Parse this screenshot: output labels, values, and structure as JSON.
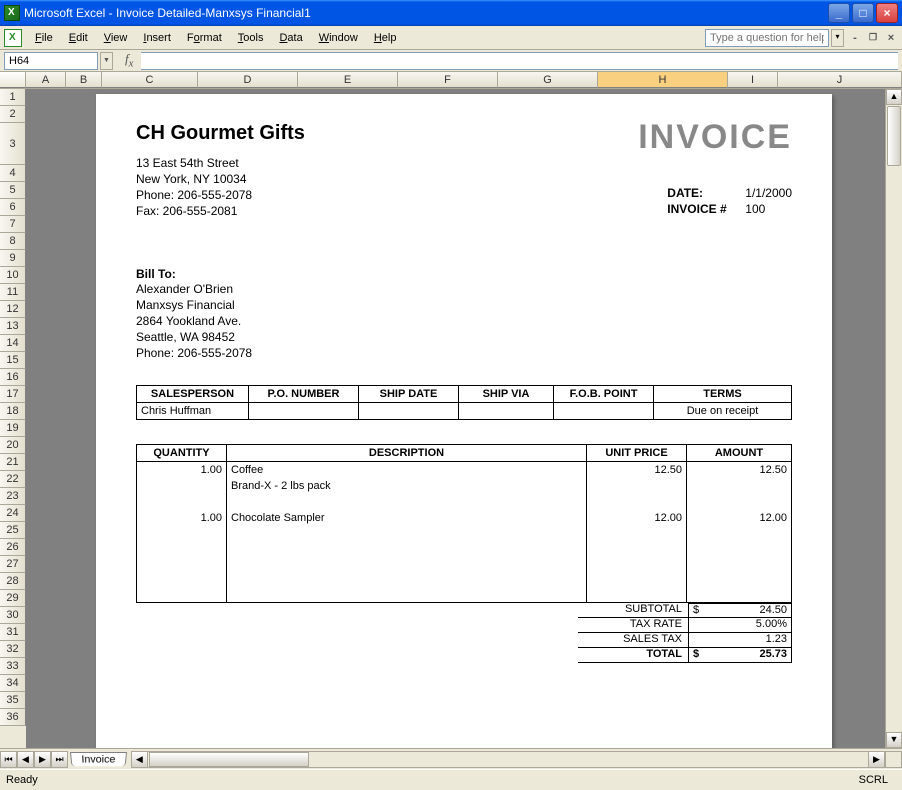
{
  "app": {
    "title": "Microsoft Excel - Invoice Detailed-Manxsys Financial1"
  },
  "menubar": {
    "file": "File",
    "edit": "Edit",
    "view": "View",
    "insert": "Insert",
    "format": "Format",
    "tools": "Tools",
    "data": "Data",
    "window": "Window",
    "help": "Help"
  },
  "helpbox": {
    "placeholder": "Type a question for help"
  },
  "namebox": {
    "value": "H64"
  },
  "columns": [
    "A",
    "B",
    "C",
    "D",
    "E",
    "F",
    "G",
    "H",
    "I",
    "J"
  ],
  "rows": [
    "1",
    "2",
    "3",
    "4",
    "5",
    "6",
    "7",
    "8",
    "9",
    "10",
    "11",
    "12",
    "13",
    "14",
    "15",
    "16",
    "17",
    "18",
    "19",
    "20",
    "21",
    "22",
    "23",
    "24",
    "25",
    "26",
    "27",
    "28",
    "29",
    "30",
    "31",
    "32",
    "33",
    "34",
    "35",
    "36"
  ],
  "invoice": {
    "company": "CH Gourmet Gifts",
    "word": "INVOICE",
    "addr1": "13 East 54th Street",
    "addr2": "New York,  NY 10034",
    "phone": "Phone: 206-555-2078",
    "fax": "Fax: 206-555-2081",
    "date_label": "DATE:",
    "date_value": "1/1/2000",
    "invno_label": "INVOICE #",
    "invno_value": "100",
    "billto_title": "Bill To:",
    "bill_name": "Alexander O'Brien",
    "bill_company": "Manxsys Financial",
    "bill_addr": "2864 Yookland Ave.",
    "bill_city": "Seattle, WA 98452",
    "bill_phone": "Phone: 206-555-2078",
    "order_hdrs": {
      "sp": "SALESPERSON",
      "po": "P.O. NUMBER",
      "sd": "SHIP DATE",
      "sv": "SHIP VIA",
      "fob": "F.O.B. POINT",
      "terms": "TERMS"
    },
    "order_row": {
      "sp": "Chris Huffman",
      "po": "",
      "sd": "",
      "sv": "",
      "fob": "",
      "terms": "Due on receipt"
    },
    "item_hdrs": {
      "qty": "QUANTITY",
      "desc": "DESCRIPTION",
      "up": "UNIT PRICE",
      "amt": "AMOUNT"
    },
    "items": [
      {
        "qty": "1.00",
        "desc1": "Coffee",
        "desc2": "Brand-X - 2 lbs pack",
        "up": "12.50",
        "amt": "12.50"
      },
      {
        "qty": "1.00",
        "desc1": "Chocolate Sampler",
        "desc2": "",
        "up": "12.00",
        "amt": "12.00"
      }
    ],
    "totals": {
      "subtotal_lbl": "SUBTOTAL",
      "subtotal": "24.50",
      "taxrate_lbl": "TAX RATE",
      "taxrate": "5.00%",
      "salestax_lbl": "SALES TAX",
      "salestax": "1.23",
      "total_lbl": "TOTAL",
      "total": "25.73",
      "currency": "$"
    }
  },
  "sheettab": {
    "name": "Invoice"
  },
  "statusbar": {
    "ready": "Ready",
    "scrl": "SCRL"
  }
}
